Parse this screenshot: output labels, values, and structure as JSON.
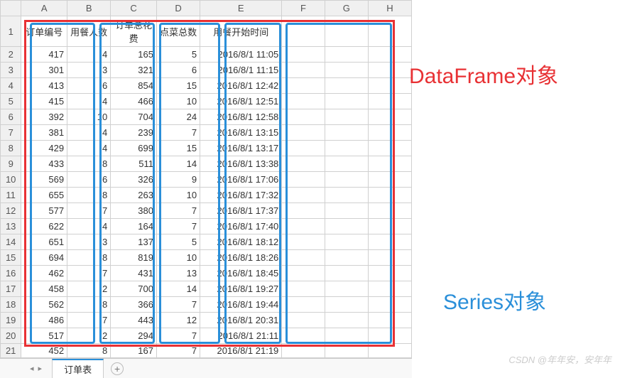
{
  "columns": {
    "A": "A",
    "B": "B",
    "C": "C",
    "D": "D",
    "E": "E",
    "F": "F",
    "G": "G",
    "H": "H"
  },
  "headers": {
    "a": "订单编号",
    "b": "用餐人数",
    "c": "订单总花费",
    "d": "点菜总数",
    "e": "用餐开始时间"
  },
  "rows": [
    {
      "n": "2",
      "a": "417",
      "b": "4",
      "c": "165",
      "d": "5",
      "e": "2016/8/1 11:05"
    },
    {
      "n": "3",
      "a": "301",
      "b": "3",
      "c": "321",
      "d": "6",
      "e": "2016/8/1 11:15"
    },
    {
      "n": "4",
      "a": "413",
      "b": "6",
      "c": "854",
      "d": "15",
      "e": "2016/8/1 12:42"
    },
    {
      "n": "5",
      "a": "415",
      "b": "4",
      "c": "466",
      "d": "10",
      "e": "2016/8/1 12:51"
    },
    {
      "n": "6",
      "a": "392",
      "b": "10",
      "c": "704",
      "d": "24",
      "e": "2016/8/1 12:58"
    },
    {
      "n": "7",
      "a": "381",
      "b": "4",
      "c": "239",
      "d": "7",
      "e": "2016/8/1 13:15"
    },
    {
      "n": "8",
      "a": "429",
      "b": "4",
      "c": "699",
      "d": "15",
      "e": "2016/8/1 13:17"
    },
    {
      "n": "9",
      "a": "433",
      "b": "8",
      "c": "511",
      "d": "14",
      "e": "2016/8/1 13:38"
    },
    {
      "n": "10",
      "a": "569",
      "b": "6",
      "c": "326",
      "d": "9",
      "e": "2016/8/1 17:06"
    },
    {
      "n": "11",
      "a": "655",
      "b": "8",
      "c": "263",
      "d": "10",
      "e": "2016/8/1 17:32"
    },
    {
      "n": "12",
      "a": "577",
      "b": "7",
      "c": "380",
      "d": "7",
      "e": "2016/8/1 17:37"
    },
    {
      "n": "13",
      "a": "622",
      "b": "4",
      "c": "164",
      "d": "7",
      "e": "2016/8/1 17:40"
    },
    {
      "n": "14",
      "a": "651",
      "b": "3",
      "c": "137",
      "d": "5",
      "e": "2016/8/1 18:12"
    },
    {
      "n": "15",
      "a": "694",
      "b": "8",
      "c": "819",
      "d": "10",
      "e": "2016/8/1 18:26"
    },
    {
      "n": "16",
      "a": "462",
      "b": "7",
      "c": "431",
      "d": "13",
      "e": "2016/8/1 18:45"
    },
    {
      "n": "17",
      "a": "458",
      "b": "2",
      "c": "700",
      "d": "14",
      "e": "2016/8/1 19:27"
    },
    {
      "n": "18",
      "a": "562",
      "b": "8",
      "c": "366",
      "d": "7",
      "e": "2016/8/1 19:44"
    },
    {
      "n": "19",
      "a": "486",
      "b": "7",
      "c": "443",
      "d": "12",
      "e": "2016/8/1 20:31"
    },
    {
      "n": "20",
      "a": "517",
      "b": "2",
      "c": "294",
      "d": "7",
      "e": "2016/8/1 21:11"
    },
    {
      "n": "21",
      "a": "452",
      "b": "8",
      "c": "167",
      "d": "7",
      "e": "2016/8/1 21:19"
    }
  ],
  "row1": "1",
  "tabs": {
    "active": "订单表",
    "add": "+"
  },
  "labels": {
    "dataframe": "DataFrame对象",
    "series": "Series对象"
  },
  "watermark": "CSDN @年年安，安年年"
}
